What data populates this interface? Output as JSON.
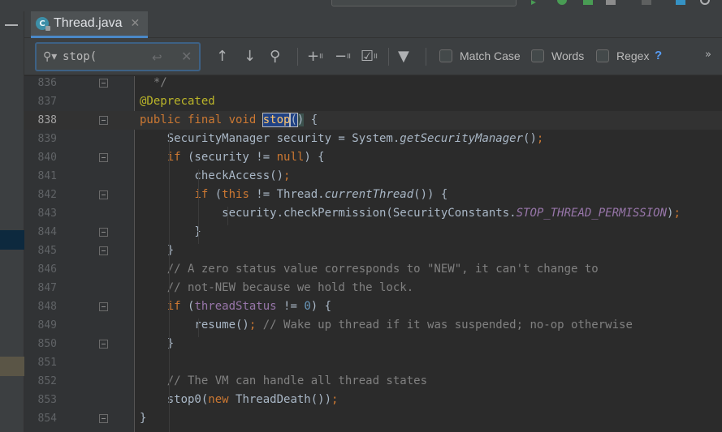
{
  "tab": {
    "label": "Thread.java",
    "icon": "class-icon",
    "icon_letter": "C"
  },
  "search": {
    "value": "stop(",
    "placeholder": ""
  },
  "options": [
    {
      "label": "Match Case",
      "checked": false
    },
    {
      "label": "Words",
      "checked": false
    },
    {
      "label": "Regex",
      "checked": false
    }
  ],
  "help_label": "?",
  "more_label": "»",
  "current_line": "838",
  "code_lines": [
    {
      "n": "836",
      "tokens": [
        {
          "t": "  */",
          "c": "cm"
        }
      ]
    },
    {
      "n": "837",
      "tokens": [
        {
          "t": "@Deprecated",
          "c": "an"
        }
      ]
    },
    {
      "n": "838",
      "tokens": [
        {
          "t": "public final void ",
          "c": "kw"
        },
        {
          "t": "stop",
          "c": "fn match"
        },
        {
          "t": "(",
          "c": "match"
        },
        {
          "t": ")",
          "c": "bracket"
        },
        {
          "t": " {",
          "c": ""
        }
      ]
    },
    {
      "n": "839",
      "tokens": [
        {
          "t": "    SecurityManager security = System.",
          "c": ""
        },
        {
          "t": "getSecurityManager",
          "c": "it"
        },
        {
          "t": "()",
          "c": ""
        },
        {
          "t": ";",
          "c": "kw"
        }
      ]
    },
    {
      "n": "840",
      "tokens": [
        {
          "t": "    ",
          "c": ""
        },
        {
          "t": "if",
          "c": "kw"
        },
        {
          "t": " (security != ",
          "c": ""
        },
        {
          "t": "null",
          "c": "kw"
        },
        {
          "t": ") {",
          "c": ""
        }
      ]
    },
    {
      "n": "841",
      "tokens": [
        {
          "t": "        checkAccess()",
          "c": ""
        },
        {
          "t": ";",
          "c": "kw"
        }
      ]
    },
    {
      "n": "842",
      "tokens": [
        {
          "t": "        ",
          "c": ""
        },
        {
          "t": "if",
          "c": "kw"
        },
        {
          "t": " (",
          "c": ""
        },
        {
          "t": "this",
          "c": "kw"
        },
        {
          "t": " != Thread.",
          "c": ""
        },
        {
          "t": "currentThread",
          "c": "it"
        },
        {
          "t": "()) {",
          "c": ""
        }
      ]
    },
    {
      "n": "843",
      "tokens": [
        {
          "t": "            security.checkPermission(SecurityConstants.",
          "c": ""
        },
        {
          "t": "STOP_THREAD_PERMISSION",
          "c": "cst"
        },
        {
          "t": ")",
          "c": ""
        },
        {
          "t": ";",
          "c": "kw"
        }
      ]
    },
    {
      "n": "844",
      "tokens": [
        {
          "t": "        }",
          "c": ""
        }
      ]
    },
    {
      "n": "845",
      "tokens": [
        {
          "t": "    }",
          "c": ""
        }
      ]
    },
    {
      "n": "846",
      "tokens": [
        {
          "t": "    // A zero status value corresponds to \"NEW\", it can't change to",
          "c": "cm"
        }
      ]
    },
    {
      "n": "847",
      "tokens": [
        {
          "t": "    // not-NEW because we hold the lock.",
          "c": "cm"
        }
      ]
    },
    {
      "n": "848",
      "tokens": [
        {
          "t": "    ",
          "c": ""
        },
        {
          "t": "if",
          "c": "kw"
        },
        {
          "t": " (",
          "c": ""
        },
        {
          "t": "threadStatus",
          "c": "fld"
        },
        {
          "t": " != ",
          "c": ""
        },
        {
          "t": "0",
          "c": "nu"
        },
        {
          "t": ") {",
          "c": ""
        }
      ]
    },
    {
      "n": "849",
      "tokens": [
        {
          "t": "        resume()",
          "c": ""
        },
        {
          "t": ";",
          "c": "kw"
        },
        {
          "t": " // Wake up thread if it was suspended; no-op otherwise",
          "c": "cm"
        }
      ]
    },
    {
      "n": "850",
      "tokens": [
        {
          "t": "    }",
          "c": ""
        }
      ]
    },
    {
      "n": "851",
      "tokens": [
        {
          "t": "",
          "c": ""
        }
      ]
    },
    {
      "n": "852",
      "tokens": [
        {
          "t": "    // The VM can handle all thread states",
          "c": "cm"
        }
      ]
    },
    {
      "n": "853",
      "tokens": [
        {
          "t": "    stop0(",
          "c": ""
        },
        {
          "t": "new",
          "c": "kw"
        },
        {
          "t": " ThreadDeath())",
          "c": ""
        },
        {
          "t": ";",
          "c": "kw"
        }
      ]
    },
    {
      "n": "854",
      "tokens": [
        {
          "t": "}",
          "c": ""
        }
      ]
    }
  ]
}
